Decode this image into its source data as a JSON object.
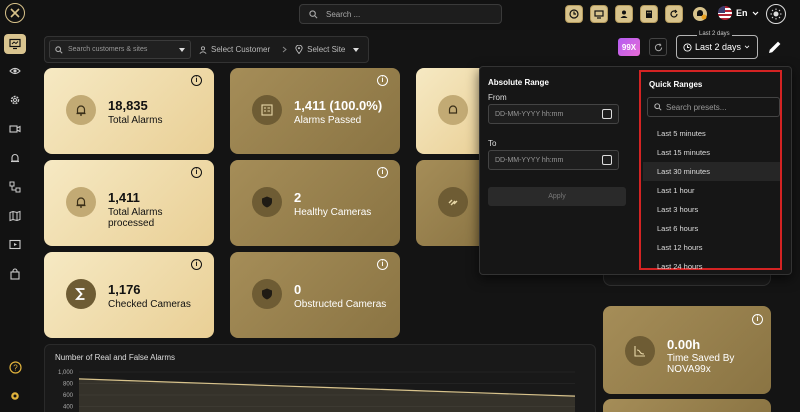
{
  "topbar": {
    "search_placeholder": "Search ...",
    "language": "En"
  },
  "filters": {
    "search_placeholder": "Search customers & sites",
    "customer_label": "Select Customer",
    "site_label": "Select Site"
  },
  "header": {
    "badge": "99X",
    "range_legend": "Last 2 days",
    "range_value": "Last 2 days"
  },
  "cards": [
    {
      "value": "18,835",
      "label": "Total Alarms"
    },
    {
      "value": "1,411 (100.0%)",
      "label": "Alarms Passed"
    },
    {
      "value": "1,411",
      "label": "Total Alarms processed"
    },
    {
      "value": "2",
      "label": "Healthy Cameras"
    },
    {
      "value": "1,176",
      "label": "Checked Cameras"
    },
    {
      "value": "0",
      "label": "Obstructed Cameras"
    }
  ],
  "time_saved": {
    "value": "0.00h",
    "label": "Time Saved By NOVA99x"
  },
  "chart": {
    "title": "Number of Real and False Alarms"
  },
  "chart_data": {
    "type": "line",
    "title": "Number of Real and False Alarms",
    "y_ticks": [
      "1,000",
      "800",
      "600",
      "400"
    ],
    "series": [
      {
        "values": [
          880,
          850,
          820,
          790,
          760,
          730,
          700,
          670,
          640,
          610,
          580
        ]
      }
    ]
  },
  "range_panel": {
    "absolute_title": "Absolute Range",
    "from_label": "From",
    "to_label": "To",
    "from_placeholder": "DD-MM-YYYY hh:mm",
    "to_placeholder": "DD-MM-YYYY hh:mm",
    "apply_label": "Apply",
    "quick_title": "Quick Ranges",
    "quick_search_placeholder": "Search presets...",
    "quick_items": [
      "Last 5 minutes",
      "Last 15 minutes",
      "Last 30 minutes",
      "Last 1 hour",
      "Last 3 hours",
      "Last 6 hours",
      "Last 12 hours",
      "Last 24 hours"
    ]
  },
  "colors": {
    "accent": "#d9c48f",
    "highlight_box": "#d42323",
    "card_light": "#f2e2b6",
    "card_dark": "#9a8350"
  }
}
